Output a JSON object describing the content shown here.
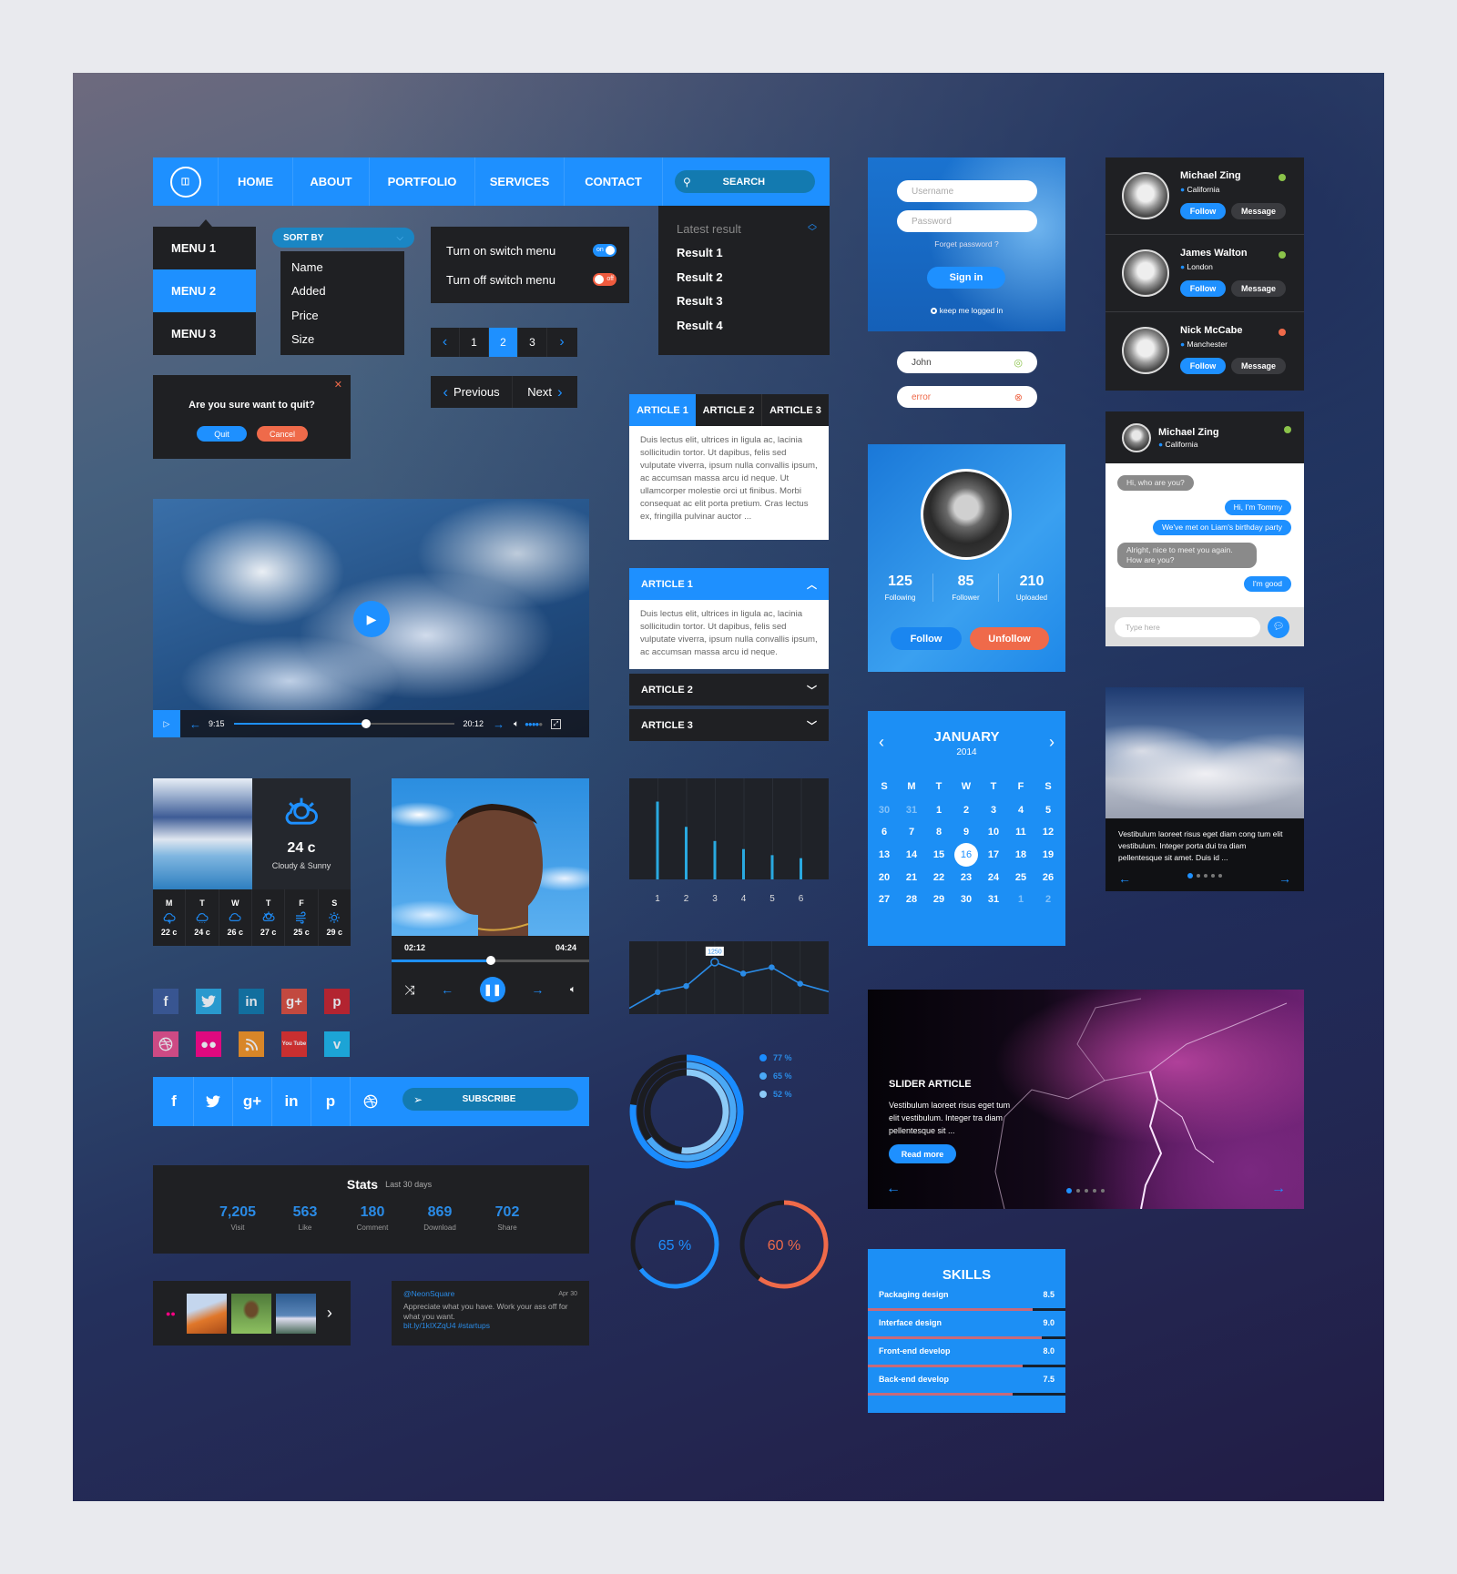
{
  "colors": {
    "accent": "#1e90ff",
    "danger": "#ef6a4a",
    "panel": "#1f2023",
    "online": "#8bc34a",
    "offline": "#ef6a4a"
  },
  "nav": {
    "logo": "logo-icon",
    "items": [
      "HOME",
      "ABOUT",
      "PORTFOLIO",
      "SERVICES",
      "CONTACT"
    ],
    "search_placeholder": "SEARCH"
  },
  "menu": {
    "items": [
      "MENU 1",
      "MENU 2",
      "MENU 3"
    ],
    "active": "MENU 2"
  },
  "sort": {
    "label": "SORT BY",
    "options": [
      "Name",
      "Added",
      "Price",
      "Size"
    ]
  },
  "switches": [
    {
      "label": "Turn on switch menu",
      "state": "on"
    },
    {
      "label": "Turn off switch menu",
      "state": "off"
    }
  ],
  "results": {
    "header": "Latest result",
    "items": [
      "Result 1",
      "Result 2",
      "Result 3",
      "Result 4"
    ]
  },
  "pagination": {
    "pages": [
      "1",
      "2",
      "3"
    ],
    "current": "2"
  },
  "prevnext": {
    "prev": "Previous",
    "next": "Next"
  },
  "dialog": {
    "title": "Are you sure want to quit?",
    "quit": "Quit",
    "cancel": "Cancel"
  },
  "tabs": {
    "items": [
      "ARTICLE 1",
      "ARTICLE 2",
      "ARTICLE 3"
    ],
    "active": "ARTICLE 1",
    "content": "Duis lectus elit, ultrices in ligula ac, lacinia sollicitudin tortor. Ut dapibus, felis sed vulputate viverra, ipsum nulla convallis ipsum, ac accumsan massa arcu id neque. Ut ullamcorper molestie orci ut finibus. Morbi consequat ac elit porta pretium. Cras lectus ex, fringilla pulvinar auctor ..."
  },
  "accordion": {
    "items": [
      {
        "title": "ARTICLE 1",
        "open": true,
        "content": "Duis lectus elit, ultrices in ligula ac, lacinia sollicitudin tortor. Ut dapibus, felis sed vulputate viverra, ipsum nulla convallis ipsum, ac accumsan massa arcu id neque."
      },
      {
        "title": "ARTICLE 2",
        "open": false
      },
      {
        "title": "ARTICLE 3",
        "open": false
      }
    ]
  },
  "video": {
    "current": "9:15",
    "duration": "20:12",
    "progress": 0.6,
    "volume": 0.8
  },
  "weather": {
    "temp": "24 c",
    "condition": "Cloudy & Sunny",
    "icon": "partly-cloudy-icon",
    "days": [
      {
        "day": "M",
        "icon": "cloud-lightning",
        "temp": "22 c"
      },
      {
        "day": "T",
        "icon": "cloud-rain",
        "temp": "24 c"
      },
      {
        "day": "W",
        "icon": "cloud",
        "temp": "26 c"
      },
      {
        "day": "T",
        "icon": "partly-cloudy",
        "temp": "27 c"
      },
      {
        "day": "F",
        "icon": "wind",
        "temp": "25 c"
      },
      {
        "day": "S",
        "icon": "sun",
        "temp": "29 c"
      }
    ]
  },
  "music": {
    "current": "02:12",
    "duration": "04:24",
    "progress": 0.5
  },
  "social_icons": [
    {
      "name": "facebook",
      "glyph": "f",
      "color": "#3b5998"
    },
    {
      "name": "twitter",
      "glyph": "",
      "color": "#29a9e0"
    },
    {
      "name": "linkedin",
      "glyph": "in",
      "color": "#0e76a8"
    },
    {
      "name": "google-plus",
      "glyph": "g+",
      "color": "#dd4b39"
    },
    {
      "name": "pinterest",
      "glyph": "p",
      "color": "#cb2027"
    },
    {
      "name": "dribbble",
      "glyph": "",
      "color": "#ea4c89"
    },
    {
      "name": "flickr",
      "glyph": "●●",
      "color": "#ff0084"
    },
    {
      "name": "rss",
      "glyph": "",
      "color": "#f7931e"
    },
    {
      "name": "youtube",
      "glyph": "You Tube",
      "color": "#e52d27"
    },
    {
      "name": "vimeo",
      "glyph": "v",
      "color": "#1ab7ea"
    }
  ],
  "share_bar": {
    "icons": [
      {
        "name": "facebook",
        "glyph": "f"
      },
      {
        "name": "twitter",
        "glyph": ""
      },
      {
        "name": "google-plus",
        "glyph": "g+"
      },
      {
        "name": "linkedin",
        "glyph": "in"
      },
      {
        "name": "pinterest",
        "glyph": "p"
      },
      {
        "name": "dribbble",
        "glyph": ""
      }
    ],
    "subscribe": "SUBSCRIBE"
  },
  "stats": {
    "title": "Stats",
    "period": "Last 30 days",
    "items": [
      {
        "value": "7,205",
        "label": "Visit"
      },
      {
        "value": "563",
        "label": "Like"
      },
      {
        "value": "180",
        "label": "Comment"
      },
      {
        "value": "869",
        "label": "Download"
      },
      {
        "value": "702",
        "label": "Share"
      }
    ]
  },
  "tweet": {
    "handle": "@NeonSquare",
    "date": "Apr 30",
    "text": "Appreciate what you have. Work your ass off for what you want.",
    "link": "bit.ly/1kIXZqU4 #startups"
  },
  "login": {
    "username_placeholder": "Username",
    "password_placeholder": "Password",
    "forgot": "Forget password ?",
    "signin": "Sign in",
    "remember": "keep me logged in"
  },
  "inputs": {
    "valid_value": "John",
    "error_value": "error"
  },
  "profile": {
    "stats": [
      {
        "value": "125",
        "label": "Following"
      },
      {
        "value": "85",
        "label": "Follower"
      },
      {
        "value": "210",
        "label": "Uploaded"
      }
    ],
    "follow": "Follow",
    "unfollow": "Unfollow"
  },
  "calendar": {
    "month": "JANUARY",
    "year": "2014",
    "weekdays": [
      "S",
      "M",
      "T",
      "W",
      "T",
      "F",
      "S"
    ],
    "weeks": [
      [
        "30",
        "31",
        "1",
        "2",
        "3",
        "4",
        "5"
      ],
      [
        "6",
        "7",
        "8",
        "9",
        "10",
        "11",
        "12"
      ],
      [
        "13",
        "14",
        "15",
        "16",
        "17",
        "18",
        "19"
      ],
      [
        "20",
        "21",
        "22",
        "23",
        "24",
        "25",
        "26"
      ],
      [
        "27",
        "28",
        "29",
        "30",
        "31",
        "1",
        "2"
      ]
    ],
    "selected": "16"
  },
  "slider": {
    "title": "SLIDER ARTICLE",
    "text": "Vestibulum laoreet risus eget tum elit vestibulum. Integer tra diam pellentesque sit ...",
    "button": "Read more",
    "slides": 5,
    "active_slide": 1
  },
  "skills": {
    "title": "SKILLS",
    "max": 10,
    "items": [
      {
        "name": "Packaging design",
        "value": "8.5"
      },
      {
        "name": "Interface design",
        "value": "9.0"
      },
      {
        "name": "Front-end develop",
        "value": "8.0"
      },
      {
        "name": "Back-end develop",
        "value": "7.5"
      }
    ]
  },
  "users": [
    {
      "name": "Michael Zing",
      "location": "California",
      "status": "online"
    },
    {
      "name": "James Walton",
      "location": "London",
      "status": "online"
    },
    {
      "name": "Nick McCabe",
      "location": "Manchester",
      "status": "offline"
    }
  ],
  "user_actions": {
    "follow": "Follow",
    "message": "Message"
  },
  "chat": {
    "name": "Michael Zing",
    "location": "California",
    "status": "online",
    "messages": [
      {
        "from": "them",
        "text": "Hi, who are you?"
      },
      {
        "from": "me",
        "text": "Hi, I'm Tommy"
      },
      {
        "from": "me",
        "text": "We've met on Liam's birthday party"
      },
      {
        "from": "them",
        "text": "Alright, nice to meet you again. How are you?"
      },
      {
        "from": "me",
        "text": "I'm good"
      }
    ],
    "placeholder": "Type here"
  },
  "cloud_card": {
    "text": "Vestibulum laoreet risus eget diam cong tum elit vestibulum. Integer porta dui tra diam pellentesque sit amet. Duis id ...",
    "slides": 5,
    "active_slide": 1
  },
  "chart_data": [
    {
      "type": "bar",
      "categories": [
        "1",
        "2",
        "3",
        "4",
        "5",
        "6"
      ],
      "values": [
        77,
        52,
        38,
        30,
        24,
        21
      ],
      "ylim": [
        0,
        100
      ],
      "grid": true,
      "color": "#29a9e0"
    },
    {
      "type": "line",
      "x": [
        1,
        2,
        3,
        4,
        5,
        6,
        7,
        8
      ],
      "values": [
        140,
        530,
        675,
        1250,
        975,
        1125,
        730,
        540
      ],
      "annotation": "1250",
      "ylim": [
        0,
        1750
      ],
      "grid": true,
      "color": "#2a8be6"
    },
    {
      "type": "pie",
      "style": "concentric-rings",
      "series": [
        {
          "name": "77 %",
          "value": 77,
          "color": "#1a8cff"
        },
        {
          "name": "65 %",
          "value": 65,
          "color": "#4aa8f5"
        },
        {
          "name": "52 %",
          "value": 52,
          "color": "#8ccaf7"
        }
      ],
      "legend": "right"
    },
    {
      "type": "pie",
      "style": "ring",
      "value": 65,
      "label": "65 %",
      "color": "#1e90ff"
    },
    {
      "type": "pie",
      "style": "ring",
      "value": 60,
      "label": "60 %",
      "color": "#ef6a4a"
    }
  ]
}
